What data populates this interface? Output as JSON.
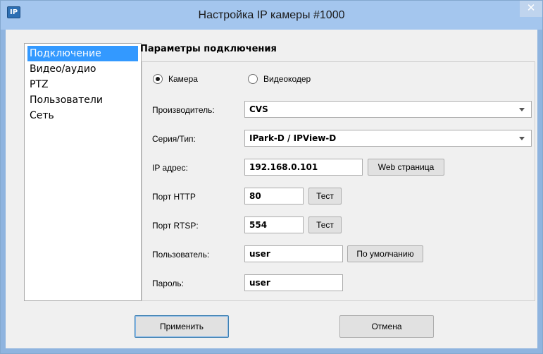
{
  "window": {
    "title": "Настройка IP камеры #1000",
    "icon_text": "IP",
    "close_glyph": "✕"
  },
  "sidebar": {
    "items": [
      {
        "label": "Подключение",
        "selected": true
      },
      {
        "label": "Видео/аудио",
        "selected": false
      },
      {
        "label": "PTZ",
        "selected": false
      },
      {
        "label": "Пользователи",
        "selected": false
      },
      {
        "label": "Сеть",
        "selected": false
      }
    ]
  },
  "connection": {
    "group_title": "Параметры подключения",
    "device_type": {
      "options": [
        "Камера",
        "Видеокодер"
      ],
      "selected": "Камера"
    },
    "manufacturer": {
      "label": "Производитель:",
      "value": "CVS"
    },
    "series": {
      "label": "Серия/Тип:",
      "value": "IPark-D / IPView-D"
    },
    "ip": {
      "label": "IP адрес:",
      "value": "192.168.0.101",
      "button": "Web страница"
    },
    "http_port": {
      "label": "Порт HTTP",
      "value": "80",
      "button": "Тест"
    },
    "rtsp_port": {
      "label": "Порт RTSP:",
      "value": "554",
      "button": "Тест"
    },
    "user": {
      "label": "Пользователь:",
      "value": "user",
      "button": "По умолчанию"
    },
    "password": {
      "label": "Пароль:",
      "value": "user"
    }
  },
  "footer": {
    "apply_label": "Применить",
    "cancel_label": "Отмена"
  }
}
